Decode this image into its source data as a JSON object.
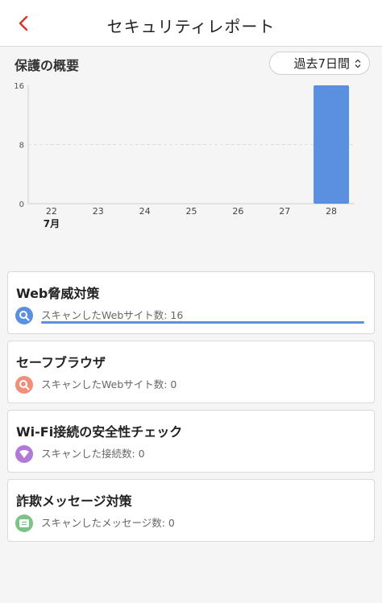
{
  "header": {
    "title": "セキュリティレポート"
  },
  "overview": {
    "title": "保護の概要",
    "period": "過去7日間"
  },
  "chart_data": {
    "type": "bar",
    "categories": [
      "22",
      "23",
      "24",
      "25",
      "26",
      "27",
      "28"
    ],
    "values": [
      0,
      0,
      0,
      0,
      0,
      0,
      16
    ],
    "month_label": "7月",
    "y_ticks": [
      0,
      8,
      16
    ],
    "ylim": [
      0,
      16
    ],
    "bar_color": "#5b8fe0"
  },
  "cards": [
    {
      "title": "Web脅威対策",
      "subtitle": "スキャンしたWebサイト数: 16",
      "icon": "search-icon",
      "color": "#5b8fe0",
      "progress": 1.0
    },
    {
      "title": "セーフブラウザ",
      "subtitle": "スキャンしたWebサイト数: 0",
      "icon": "search-icon",
      "color": "#f0907a"
    },
    {
      "title": "Wi-Fi接続の安全性チェック",
      "subtitle": "スキャンした接続数: 0",
      "icon": "wifi-icon",
      "color": "#b07ad6"
    },
    {
      "title": "詐欺メッセージ対策",
      "subtitle": "スキャンしたメッセージ数: 0",
      "icon": "message-icon",
      "color": "#7cc486"
    }
  ]
}
